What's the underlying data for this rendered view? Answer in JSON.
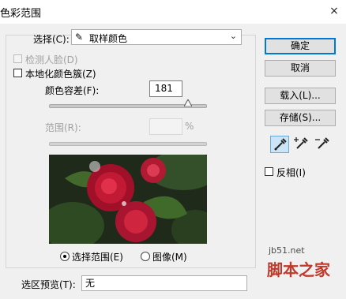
{
  "window": {
    "title": "色彩范围",
    "close": "×"
  },
  "select_row": {
    "label": "选择(C):",
    "value": "取样颜色"
  },
  "detect_faces": {
    "label": "检测人脸(D)"
  },
  "localized": {
    "label": "本地化颜色簇(Z)"
  },
  "fuzziness": {
    "label": "颜色容差(F):",
    "value": "181",
    "fraction": 0.88
  },
  "range": {
    "label": "范围(R):",
    "value": "",
    "unit": "%"
  },
  "view": {
    "selection_label": "选择范围(E)",
    "image_label": "图像(M)",
    "selected": "selection"
  },
  "preview_row": {
    "label": "选区预览(T):",
    "value": "无"
  },
  "buttons": {
    "ok": "确定",
    "cancel": "取消",
    "load": "载入(L)...",
    "save": "存储(S)..."
  },
  "invert": {
    "label": "反相(I)"
  },
  "tools": [
    "eyedropper-icon",
    "eyedropper-plus-icon",
    "eyedropper-minus-icon"
  ],
  "watermark": {
    "site": "jb51.net",
    "brand": "脚本之家"
  },
  "colors": {
    "accent": "#0078d7",
    "tool_active": "#cce4f7"
  }
}
